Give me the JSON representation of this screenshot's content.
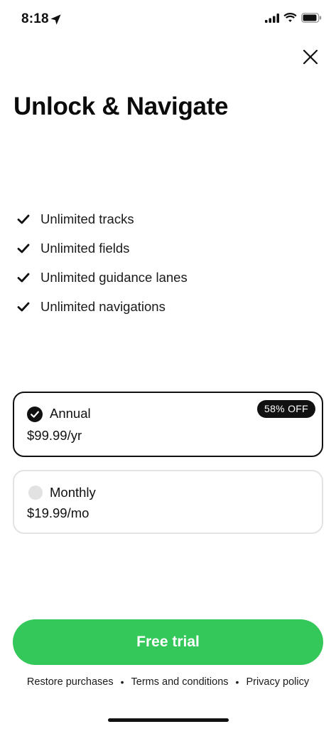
{
  "status_bar": {
    "time": "8:18"
  },
  "header": {
    "title": "Unlock & Navigate"
  },
  "features": [
    {
      "label": "Unlimited tracks"
    },
    {
      "label": "Unlimited fields"
    },
    {
      "label": "Unlimited guidance lanes"
    },
    {
      "label": "Unlimited navigations"
    }
  ],
  "plans": [
    {
      "name": "Annual",
      "price": "$99.99/yr",
      "badge": "58% OFF",
      "selected": true
    },
    {
      "name": "Monthly",
      "price": "$19.99/mo",
      "selected": false
    }
  ],
  "cta": {
    "label": "Free trial"
  },
  "footer": {
    "restore": "Restore purchases",
    "terms": "Terms and conditions",
    "privacy": "Privacy policy",
    "separator": "•"
  },
  "colors": {
    "accent": "#34c759",
    "text": "#111111",
    "card_border_selected": "#111111",
    "card_border_unselected": "#e3e3e3",
    "radio_unselected": "#e2e2e2",
    "badge_bg": "#111111"
  }
}
